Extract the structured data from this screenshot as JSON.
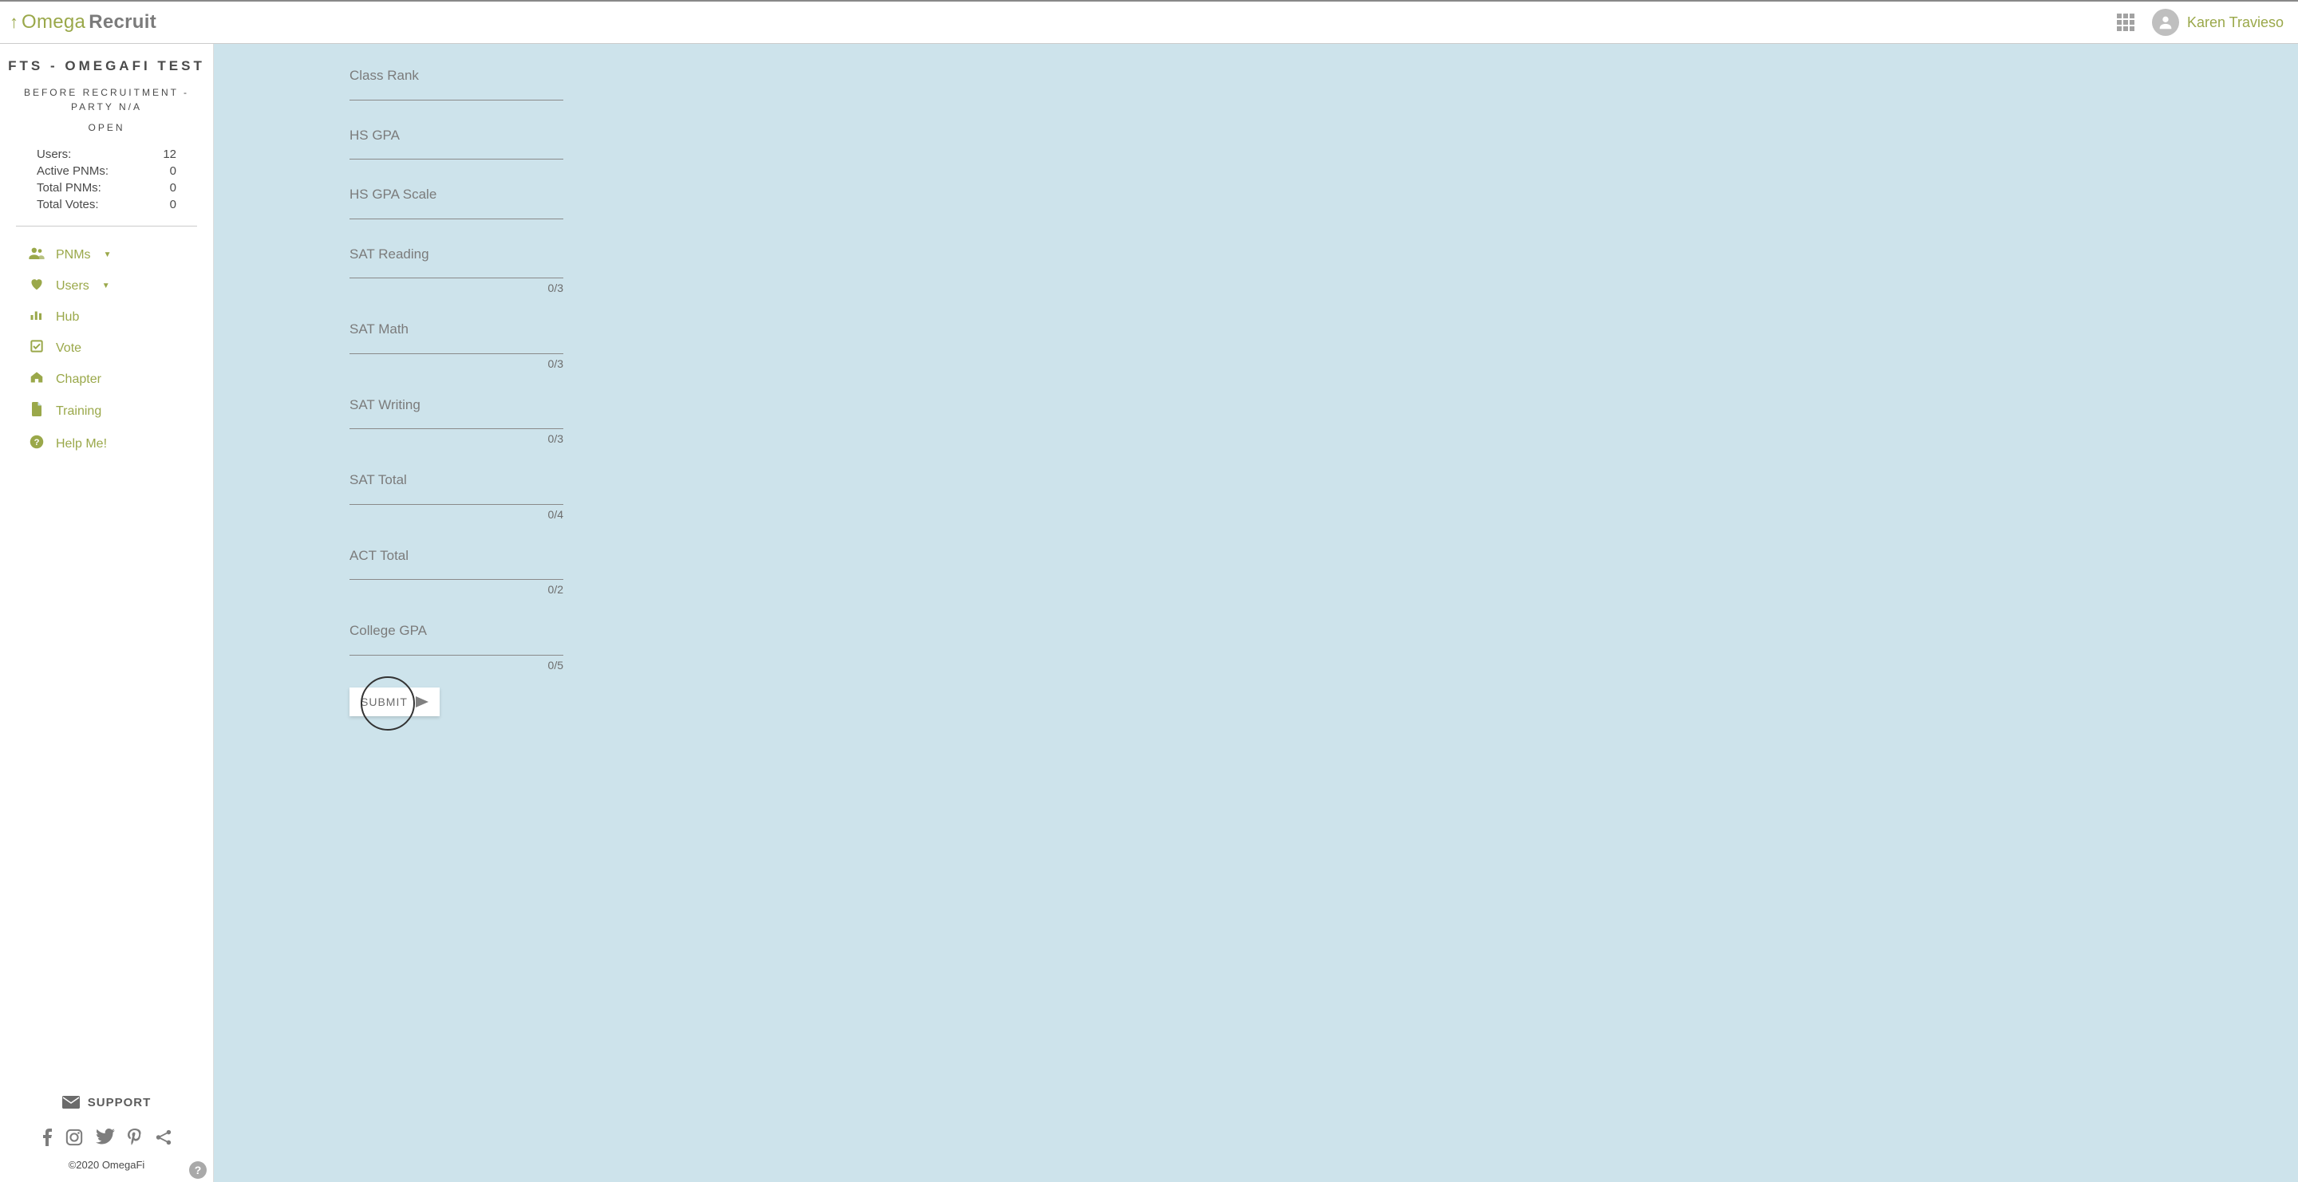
{
  "header": {
    "logo_word1": "Omega",
    "logo_word2": "Recruit",
    "username": "Karen Travieso"
  },
  "sidebar": {
    "title": "FTS - OMEGAFI TEST",
    "subtitle": "BEFORE RECRUITMENT - PARTY N/A",
    "status": "OPEN",
    "stats": {
      "users_label": "Users:",
      "users_val": "12",
      "active_label": "Active PNMs:",
      "active_val": "0",
      "total_pnm_label": "Total PNMs:",
      "total_pnm_val": "0",
      "total_votes_label": "Total Votes:",
      "total_votes_val": "0"
    },
    "nav": {
      "pnms": "PNMs",
      "users": "Users",
      "hub": "Hub",
      "vote": "Vote",
      "chapter": "Chapter",
      "training": "Training",
      "help": "Help Me!"
    },
    "support": "SUPPORT",
    "copyright": "©2020 OmegaFi"
  },
  "form": {
    "fields": {
      "class_rank": {
        "label": "Class Rank",
        "counter": ""
      },
      "hs_gpa": {
        "label": "HS GPA",
        "counter": ""
      },
      "hs_gpa_scale": {
        "label": "HS GPA Scale",
        "counter": ""
      },
      "sat_reading": {
        "label": "SAT Reading",
        "counter": "0/3"
      },
      "sat_math": {
        "label": "SAT Math",
        "counter": "0/3"
      },
      "sat_writing": {
        "label": "SAT Writing",
        "counter": "0/3"
      },
      "sat_total": {
        "label": "SAT Total",
        "counter": "0/4"
      },
      "act_total": {
        "label": "ACT Total",
        "counter": "0/2"
      },
      "college_gpa": {
        "label": "College GPA",
        "counter": "0/5"
      }
    },
    "submit_label": "SUBMIT"
  }
}
